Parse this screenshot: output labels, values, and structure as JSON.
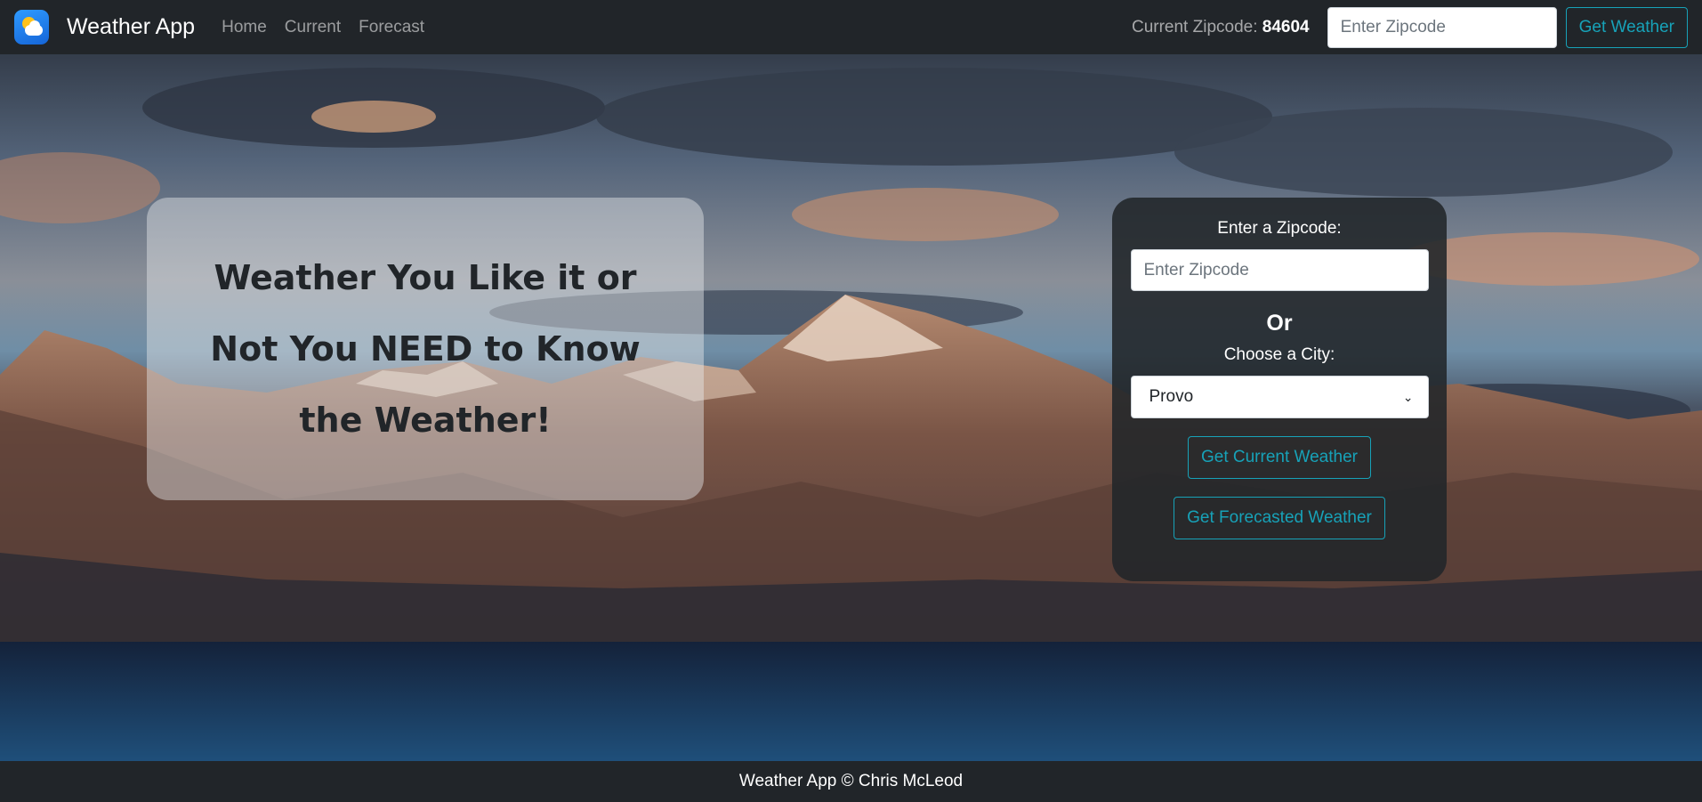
{
  "nav": {
    "brand": "Weather App",
    "links": [
      "Home",
      "Current",
      "Forecast"
    ],
    "zip_label": "Current Zipcode:",
    "zip_value": "84604",
    "zip_placeholder": "Enter Zipcode",
    "get_weather": "Get Weather"
  },
  "hero": {
    "headline": "Weather You Like it or Not You NEED to Know the Weather!"
  },
  "form": {
    "zip_label": "Enter a Zipcode:",
    "zip_placeholder": "Enter Zipcode",
    "or": "Or",
    "city_label": "Choose a City:",
    "city_selected": "Provo",
    "current_btn": "Get Current Weather",
    "forecast_btn": "Get Forecasted Weather"
  },
  "footer": {
    "text": "Weather App © Chris McLeod"
  },
  "colors": {
    "navbar": "#212529",
    "accent": "#17a2b8"
  }
}
